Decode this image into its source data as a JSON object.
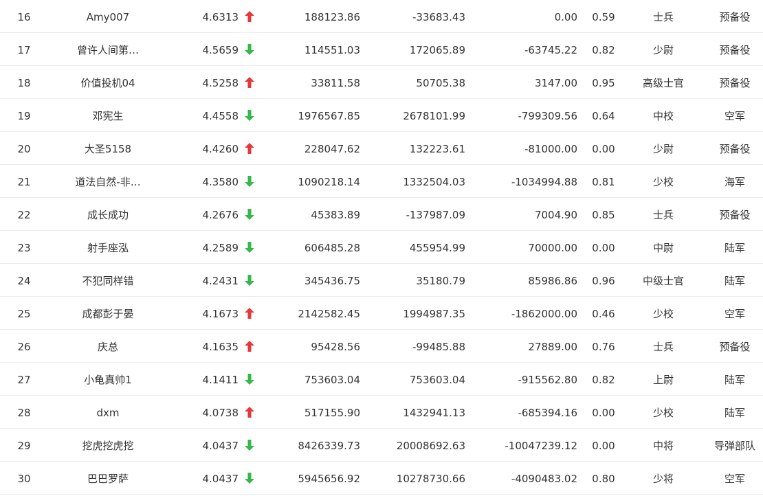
{
  "colors": {
    "up": "#e5383b",
    "down": "#34b84a",
    "text": "#333333",
    "divider": "#ececec"
  },
  "rows": [
    {
      "rank": "16",
      "name": "Amy007",
      "score": "4.6313",
      "trend": "up",
      "trend_icon": "arrow-up-icon",
      "asset": "188123.86",
      "profit": "-33683.43",
      "flow": "0.00",
      "ratio": "0.59",
      "title": "士兵",
      "corps": "预备役"
    },
    {
      "rank": "17",
      "name": "曾许人间第…",
      "score": "4.5659",
      "trend": "down",
      "trend_icon": "arrow-down-icon",
      "asset": "114551.03",
      "profit": "172065.89",
      "flow": "-63745.22",
      "ratio": "0.82",
      "title": "少尉",
      "corps": "预备役"
    },
    {
      "rank": "18",
      "name": "价值投机04",
      "score": "4.5258",
      "trend": "up",
      "trend_icon": "arrow-up-icon",
      "asset": "33811.58",
      "profit": "50705.38",
      "flow": "3147.00",
      "ratio": "0.95",
      "title": "高级士官",
      "corps": "预备役"
    },
    {
      "rank": "19",
      "name": "邓宪生",
      "score": "4.4558",
      "trend": "down",
      "trend_icon": "arrow-down-icon",
      "asset": "1976567.85",
      "profit": "2678101.99",
      "flow": "-799309.56",
      "ratio": "0.64",
      "title": "中校",
      "corps": "空军"
    },
    {
      "rank": "20",
      "name": "大圣5158",
      "score": "4.4260",
      "trend": "up",
      "trend_icon": "arrow-up-icon",
      "asset": "228047.62",
      "profit": "132223.61",
      "flow": "-81000.00",
      "ratio": "0.00",
      "title": "少尉",
      "corps": "预备役"
    },
    {
      "rank": "21",
      "name": "道法自然-非…",
      "score": "4.3580",
      "trend": "down",
      "trend_icon": "arrow-down-icon",
      "asset": "1090218.14",
      "profit": "1332504.03",
      "flow": "-1034994.88",
      "ratio": "0.81",
      "title": "少校",
      "corps": "海军"
    },
    {
      "rank": "22",
      "name": "成长成功",
      "score": "4.2676",
      "trend": "down",
      "trend_icon": "arrow-down-icon",
      "asset": "45383.89",
      "profit": "-137987.09",
      "flow": "7004.90",
      "ratio": "0.85",
      "title": "士兵",
      "corps": "预备役"
    },
    {
      "rank": "23",
      "name": "射手座泓",
      "score": "4.2589",
      "trend": "down",
      "trend_icon": "arrow-down-icon",
      "asset": "606485.28",
      "profit": "455954.99",
      "flow": "70000.00",
      "ratio": "0.00",
      "title": "中尉",
      "corps": "陆军"
    },
    {
      "rank": "24",
      "name": "不犯同样错",
      "score": "4.2431",
      "trend": "down",
      "trend_icon": "arrow-down-icon",
      "asset": "345436.75",
      "profit": "35180.79",
      "flow": "85986.86",
      "ratio": "0.96",
      "title": "中级士官",
      "corps": "陆军"
    },
    {
      "rank": "25",
      "name": "成都彭于晏",
      "score": "4.1673",
      "trend": "up",
      "trend_icon": "arrow-up-icon",
      "asset": "2142582.45",
      "profit": "1994987.35",
      "flow": "-1862000.00",
      "ratio": "0.46",
      "title": "少校",
      "corps": "空军"
    },
    {
      "rank": "26",
      "name": "庆总",
      "score": "4.1635",
      "trend": "up",
      "trend_icon": "arrow-up-icon",
      "asset": "95428.56",
      "profit": "-99485.88",
      "flow": "27889.00",
      "ratio": "0.76",
      "title": "士兵",
      "corps": "预备役"
    },
    {
      "rank": "27",
      "name": "小龟真帅1",
      "score": "4.1411",
      "trend": "down",
      "trend_icon": "arrow-down-icon",
      "asset": "753603.04",
      "profit": "753603.04",
      "flow": "-915562.80",
      "ratio": "0.82",
      "title": "上尉",
      "corps": "陆军"
    },
    {
      "rank": "28",
      "name": "dxm",
      "score": "4.0738",
      "trend": "up",
      "trend_icon": "arrow-up-icon",
      "asset": "517155.90",
      "profit": "1432941.13",
      "flow": "-685394.16",
      "ratio": "0.00",
      "title": "少校",
      "corps": "陆军"
    },
    {
      "rank": "29",
      "name": "挖虎挖虎挖",
      "score": "4.0437",
      "trend": "down",
      "trend_icon": "arrow-down-icon",
      "asset": "8426339.73",
      "profit": "20008692.63",
      "flow": "-10047239.12",
      "ratio": "0.00",
      "title": "中将",
      "corps": "导弹部队"
    },
    {
      "rank": "30",
      "name": "巴巴罗萨",
      "score": "4.0437",
      "trend": "down",
      "trend_icon": "arrow-down-icon",
      "asset": "5945656.92",
      "profit": "10278730.66",
      "flow": "-4090483.02",
      "ratio": "0.80",
      "title": "少将",
      "corps": "空军"
    }
  ]
}
